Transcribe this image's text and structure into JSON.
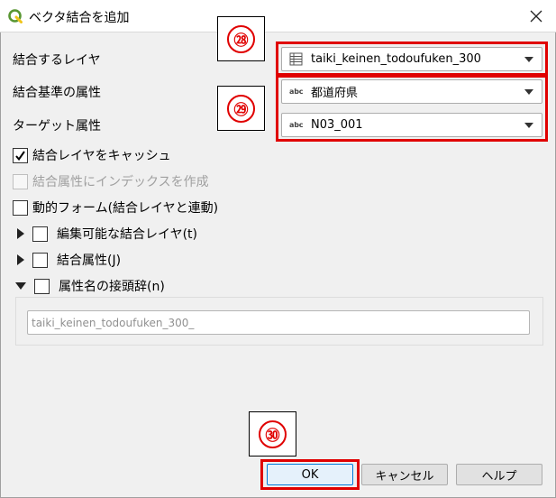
{
  "window": {
    "title": "ベクタ結合を追加"
  },
  "form": {
    "join_layer": {
      "label": "結合するレイヤ",
      "value": "taiki_keinen_todoufuken_300",
      "icon": "table-icon"
    },
    "join_field": {
      "label": "結合基準の属性",
      "value": "都道府県",
      "icon": "abc-field-icon",
      "icon_text": "abc"
    },
    "target_field": {
      "label": "ターゲット属性",
      "value": "N03_001",
      "icon": "abc-field-icon",
      "icon_text": "abc"
    }
  },
  "options": {
    "cache_join_layer": {
      "label": "結合レイヤをキャッシュ",
      "checked": true
    },
    "create_index": {
      "label": "結合属性にインデックスを作成",
      "checked": false,
      "disabled": true
    },
    "dynamic_form": {
      "label": "動的フォーム(結合レイヤと連動)",
      "checked": false
    },
    "editable_join_layer": {
      "label": "編集可能な結合レイヤ(t)",
      "checked": false,
      "expanded": false
    },
    "joined_fields": {
      "label": "結合属性(J)",
      "checked": false,
      "expanded": false
    },
    "field_prefix": {
      "label": "属性名の接頭辞(n)",
      "checked": false,
      "expanded": true,
      "value": "taiki_keinen_todoufuken_300_"
    }
  },
  "annotations": {
    "a28": "㉘",
    "a29": "㉙",
    "a30": "㉚"
  },
  "buttons": {
    "ok": "OK",
    "cancel": "キャンセル",
    "help": "ヘルプ"
  },
  "colors": {
    "highlight": "#e00000",
    "qgis_green": "#589632",
    "ok_accent": "#0078d7"
  }
}
